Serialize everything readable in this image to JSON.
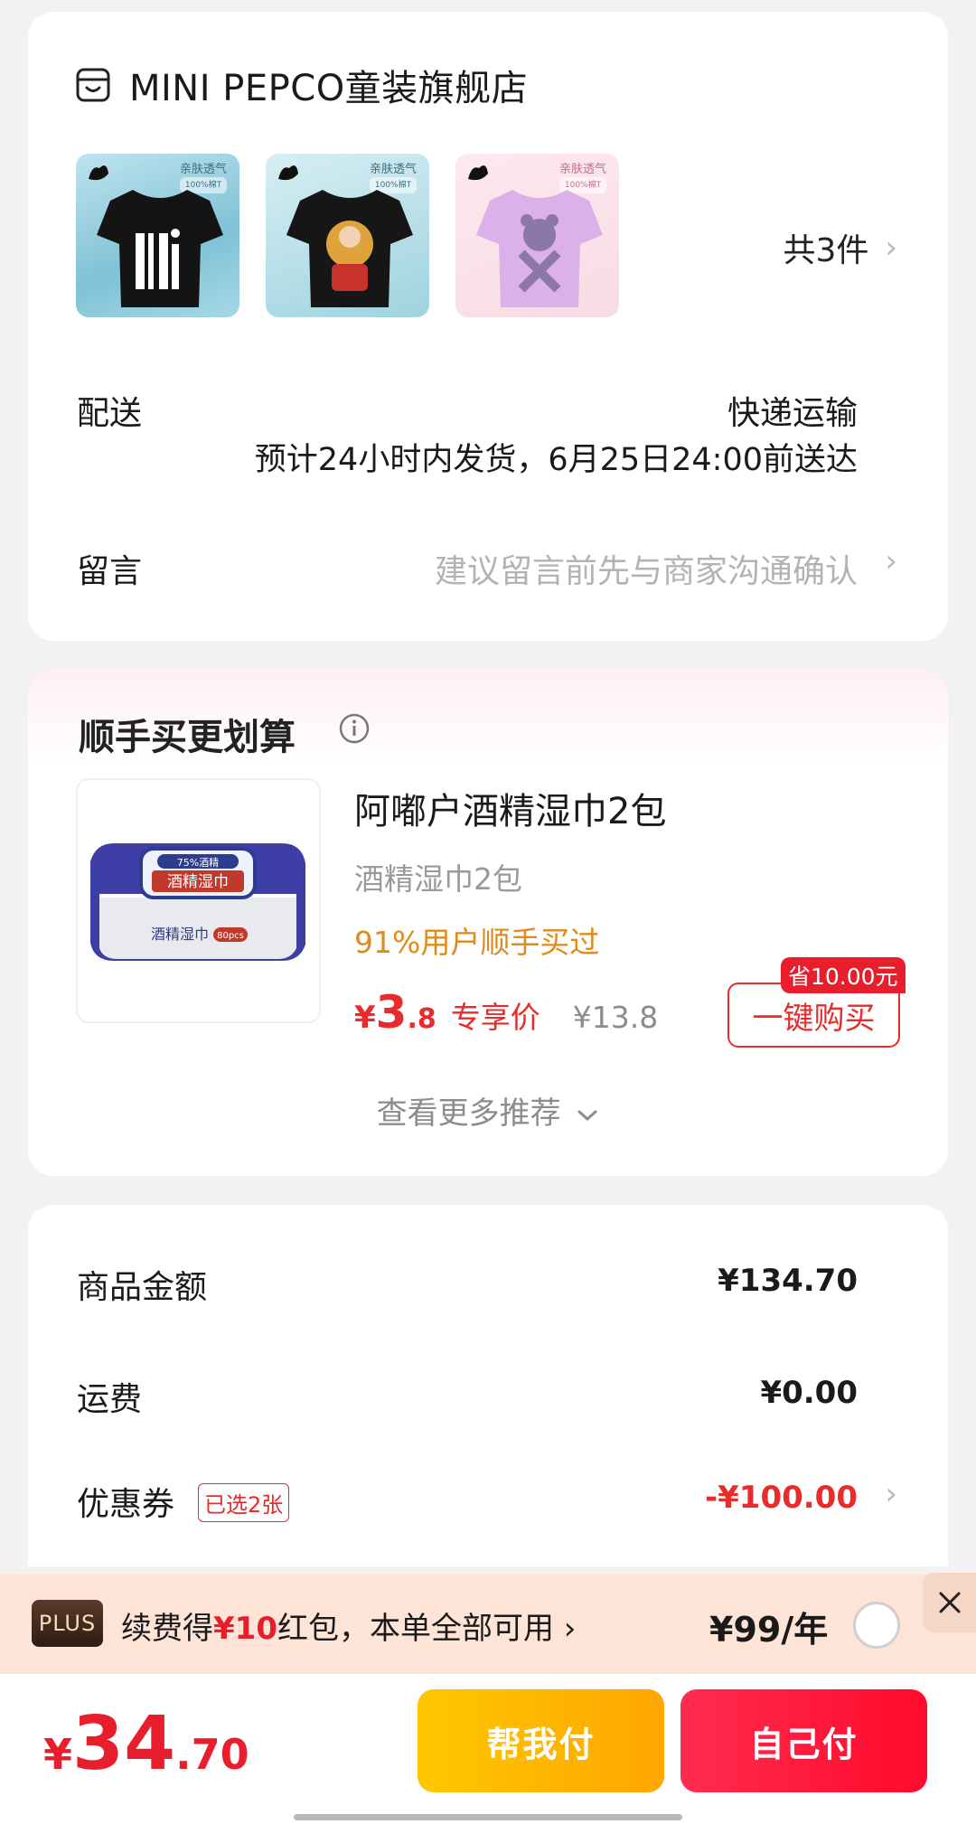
{
  "store": {
    "name": "MINI PEPCO童装旗舰店",
    "item_count": "共3件",
    "thumbs": [
      {
        "tag": "亲肤透气",
        "tag_sub": "100%棉T"
      },
      {
        "tag": "亲肤透气",
        "tag_sub": "100%棉T"
      },
      {
        "tag": "亲肤透气",
        "tag_sub": "100%棉T"
      }
    ]
  },
  "delivery": {
    "label": "配送",
    "method": "快递运输",
    "eta": "预计24小时内发货，6月25日24:00前送达"
  },
  "message": {
    "label": "留言",
    "placeholder": "建议留言前先与商家沟通确认"
  },
  "recommend": {
    "title": "顺手买更划算",
    "product_name": "阿嘟户酒精湿巾2包",
    "product_spec": "酒精湿巾2包",
    "social_proof": "91%用户顺手买过",
    "price_currency": "¥",
    "price_int": "3",
    "price_dec": ".8",
    "price_label": "专享价",
    "original_price": "¥13.8",
    "save_badge": "省10.00元",
    "buy_button": "一键购买",
    "more": "查看更多推荐",
    "product_img_label": "酒精湿巾",
    "product_img_badge": "80pcs",
    "product_img_top": "75%酒精"
  },
  "summary": {
    "goods_label": "商品金额",
    "goods_value": "¥134.70",
    "shipping_label": "运费",
    "shipping_value": "¥0.00",
    "coupon_label": "优惠券",
    "coupon_badge": "已选2张",
    "coupon_value": "-¥100.00"
  },
  "plus": {
    "badge": "PLUS",
    "text_pre": "续费得",
    "text_amount": "¥10",
    "text_post": "红包，本单全部可用",
    "price": "¥99/年"
  },
  "bottom": {
    "total_currency": "¥",
    "total_int": "34",
    "total_dec": ".70",
    "help_pay": "帮我付",
    "self_pay": "自己付"
  },
  "colors": {
    "accent_red": "#e81e2c",
    "orange": "#e08a18",
    "yellow_btn": "#ffb800",
    "plus_bg": "#fde4d6"
  }
}
